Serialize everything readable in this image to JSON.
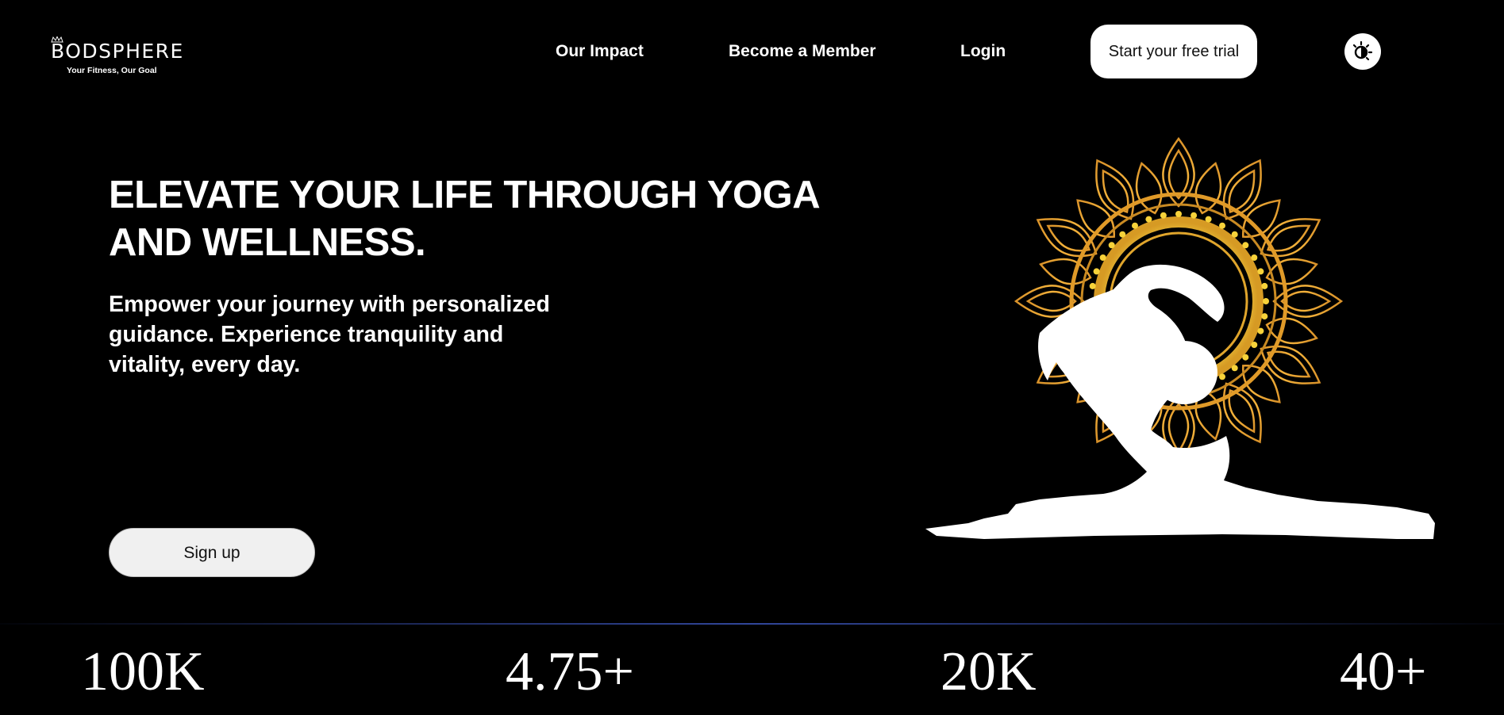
{
  "brand": {
    "name": "BODSPHERE",
    "tagline": "Your Fitness, Our Goal"
  },
  "nav": {
    "items": [
      {
        "label": "Our Impact"
      },
      {
        "label": "Become a Member"
      },
      {
        "label": "Login"
      }
    ],
    "cta_label": "Start your free trial",
    "theme_toggle_icon": "sun-moon-icon"
  },
  "hero": {
    "title": "ELEVATE YOUR LIFE THROUGH YOGA AND WELLNESS.",
    "subtitle": "Empower your journey with personalized guidance. Experience tranquility and vitality, every day.",
    "signup_label": "Sign up",
    "illustration_icon": "yoga-mandala-illustration"
  },
  "stats": [
    {
      "value": "100K",
      "label": ""
    },
    {
      "value": "4.75+",
      "label": ""
    },
    {
      "value": "20K",
      "label": ""
    },
    {
      "value": "40+",
      "label": ""
    }
  ],
  "colors": {
    "background": "#000000",
    "text": "#ffffff",
    "button": "#ffffff",
    "mandala_gold": "#e8a53a",
    "mandala_yellow": "#f7d23a",
    "divider": "#4664dc"
  }
}
